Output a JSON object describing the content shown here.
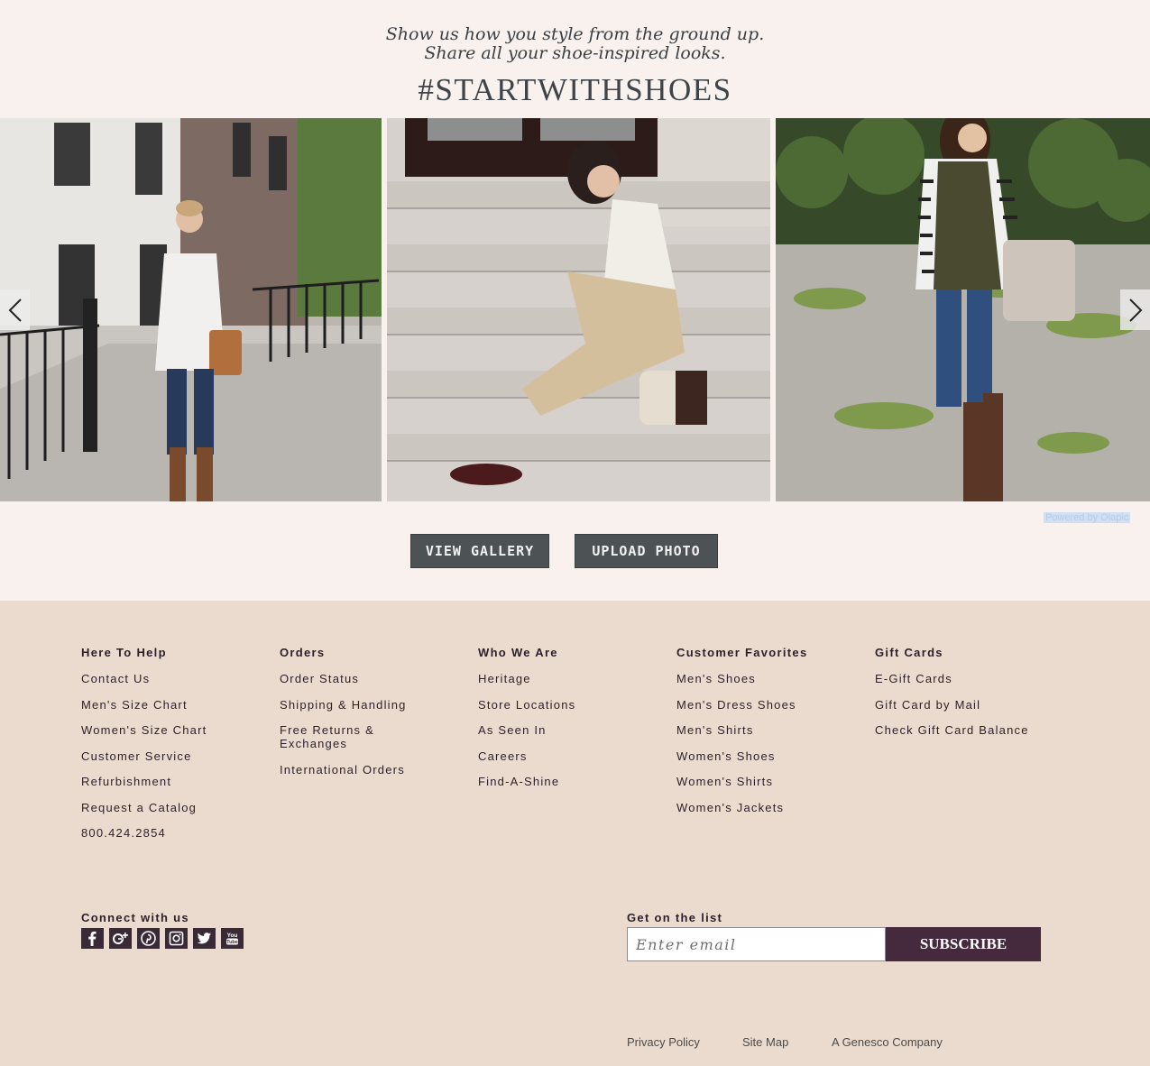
{
  "ugc": {
    "tagline_line1": "Show us how you style from the ground up.",
    "tagline_line2": "Share all your shoe-inspired looks.",
    "hashtag": "#STARTWITHSHOES",
    "powered_by": "Powered by Olapic",
    "view_gallery_label": "VIEW GALLERY",
    "upload_photo_label": "UPLOAD PHOTO"
  },
  "footer": {
    "columns": [
      {
        "heading": "Here To Help",
        "links": [
          "Contact Us",
          "Men's Size Chart",
          "Women's Size Chart",
          "Customer Service",
          "Refurbishment",
          "Request a Catalog",
          "800.424.2854"
        ]
      },
      {
        "heading": "Orders",
        "links": [
          "Order Status",
          "Shipping & Handling",
          "Free Returns & Exchanges",
          "International Orders"
        ]
      },
      {
        "heading": "Who We Are",
        "links": [
          "Heritage",
          "Store Locations",
          "As Seen In",
          "Careers",
          "Find-A-Shine"
        ]
      },
      {
        "heading": "Customer Favorites",
        "links": [
          "Men's Shoes",
          "Men's Dress Shoes",
          "Men's Shirts",
          "Women's Shoes",
          "Women's Shirts",
          "Women's Jackets"
        ]
      },
      {
        "heading": "Gift Cards",
        "links": [
          "E-Gift Cards",
          "Gift Card by Mail",
          "Check Gift Card Balance"
        ]
      }
    ],
    "connect_heading": "Connect with us",
    "social_icons": [
      "facebook-icon",
      "google-plus-icon",
      "pinterest-icon",
      "instagram-icon",
      "twitter-icon",
      "youtube-icon"
    ],
    "newsletter_heading": "Get on the list",
    "email_placeholder": "Enter email",
    "subscribe_label": "SUBSCRIBE",
    "legal_links": [
      "Privacy Policy",
      "Site Map",
      "A Genesco Company"
    ]
  },
  "colors": {
    "ugc_background": "#f8f1ed",
    "footer_background": "#ebdbce",
    "button_gray": "#4d5254",
    "subscribe_plum": "#452a3d"
  }
}
